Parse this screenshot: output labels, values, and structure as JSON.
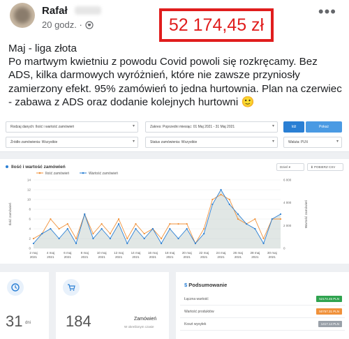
{
  "post": {
    "author": "Rafał",
    "time": "20 godz. ·",
    "highlight": "52 174,45 zł",
    "lines": [
      "Maj - liga złota",
      "Po martwym kwietniu z powodu Covid powoli się rozkręcamy. Bez",
      "ADS, kilka darmowych wyróżnień, które nie zawsze przyniosły",
      "zamierzony efekt. 95% zamówień to jedna hurtownia. Plan na czerwiec",
      "- zabawa z ADS oraz dodanie kolejnych hurtowni 🙂"
    ]
  },
  "filters": {
    "data_type": "Rodzaj danych: Ilość i wartość zamówień",
    "range": "Zakres: Poprzedni miesiąc: 01 Maj 2021 - 31 Maj 2021",
    "btn_day": "Idź",
    "btn_show": "Pokaż",
    "source": "Źródło zamówienia: Wszystkie",
    "status": "Status zamówienia: Wszystkie",
    "currency": "Waluta: PLN"
  },
  "chart_card": {
    "title": "Ilość i wartość zamówień",
    "period": "Dzień",
    "export": "⬇ POBIERZ CSV"
  },
  "chart_data": {
    "type": "line",
    "x": [
      "2 maj 2021",
      "",
      "4 maj 2021",
      "",
      "6 maj 2021",
      "",
      "8 maj 2021",
      "",
      "10 maj 2021",
      "",
      "12 maj 2021",
      "",
      "14 maj 2021",
      "",
      "16 maj 2021",
      "",
      "18 maj 2021",
      "",
      "20 maj 2021",
      "",
      "22 maj 2021",
      "",
      "24 maj 2021",
      "",
      "26 maj 2021",
      "",
      "28 maj 2021",
      "",
      "30 maj 2021",
      ""
    ],
    "x_tick_labels": [
      [
        "2 maj",
        "2021"
      ],
      [
        "4 maj",
        "2021"
      ],
      [
        "6 maj",
        "2021"
      ],
      [
        "8 maj",
        "2021"
      ],
      [
        "10 maj",
        "2021"
      ],
      [
        "12 maj",
        "2021"
      ],
      [
        "14 maj",
        "2021"
      ],
      [
        "16 maj",
        "2021"
      ],
      [
        "18 maj",
        "2021"
      ],
      [
        "20 maj",
        "2021"
      ],
      [
        "22 maj",
        "2021"
      ],
      [
        "24 maj",
        "2021"
      ],
      [
        "26 maj",
        "2021"
      ],
      [
        "28 maj",
        "2021"
      ],
      [
        "30 maj",
        "2021"
      ]
    ],
    "y_left_label": "Ilość zamówień",
    "y_right_label": "Wartość zamówień",
    "y_left_ticks": [
      "0",
      "2",
      "4",
      "6",
      "8",
      "10",
      "12",
      "14"
    ],
    "y_right_ticks": [
      "0",
      "2 000",
      "4 000",
      "6 000"
    ],
    "y_left_lim": [
      0,
      14
    ],
    "y_right_lim": [
      0,
      6000
    ],
    "series": [
      {
        "name": "Ilość zamówień",
        "color": "#f0913a",
        "axis": "left",
        "values": [
          2,
          3,
          6,
          4,
          5,
          2,
          7,
          3,
          5,
          3,
          6,
          2,
          5,
          3,
          4,
          2,
          5,
          5,
          5,
          1,
          4,
          10,
          11,
          10,
          6,
          5,
          6,
          2,
          6,
          6
        ]
      },
      {
        "name": "Wartość zamówień",
        "color": "#2a7fd4",
        "axis": "left",
        "values": [
          1,
          3,
          4,
          2,
          4,
          1,
          7,
          2,
          4,
          2,
          5,
          1,
          4,
          2,
          4,
          1,
          4,
          2,
          4,
          1,
          3,
          9,
          12,
          9,
          7,
          5,
          4,
          1,
          6,
          7
        ]
      }
    ],
    "grid": true,
    "legend": "top-left"
  },
  "stats": {
    "days": "31",
    "days_unit": "dni",
    "orders": "184",
    "orders_label": "Zamówień",
    "orders_sub": "W określonym czasie"
  },
  "summary": {
    "title": "Podsumowanie",
    "rows": [
      {
        "label": "Łączna wartość",
        "value": "52174.45 PLN",
        "color": "#2fa34f"
      },
      {
        "label": "Wartość produktów",
        "value": "50757.31 PLN",
        "color": "#f0913a"
      },
      {
        "label": "Koszt wysyłek",
        "value": "1417.14 PLN",
        "color": "#9aa1a9"
      }
    ]
  }
}
